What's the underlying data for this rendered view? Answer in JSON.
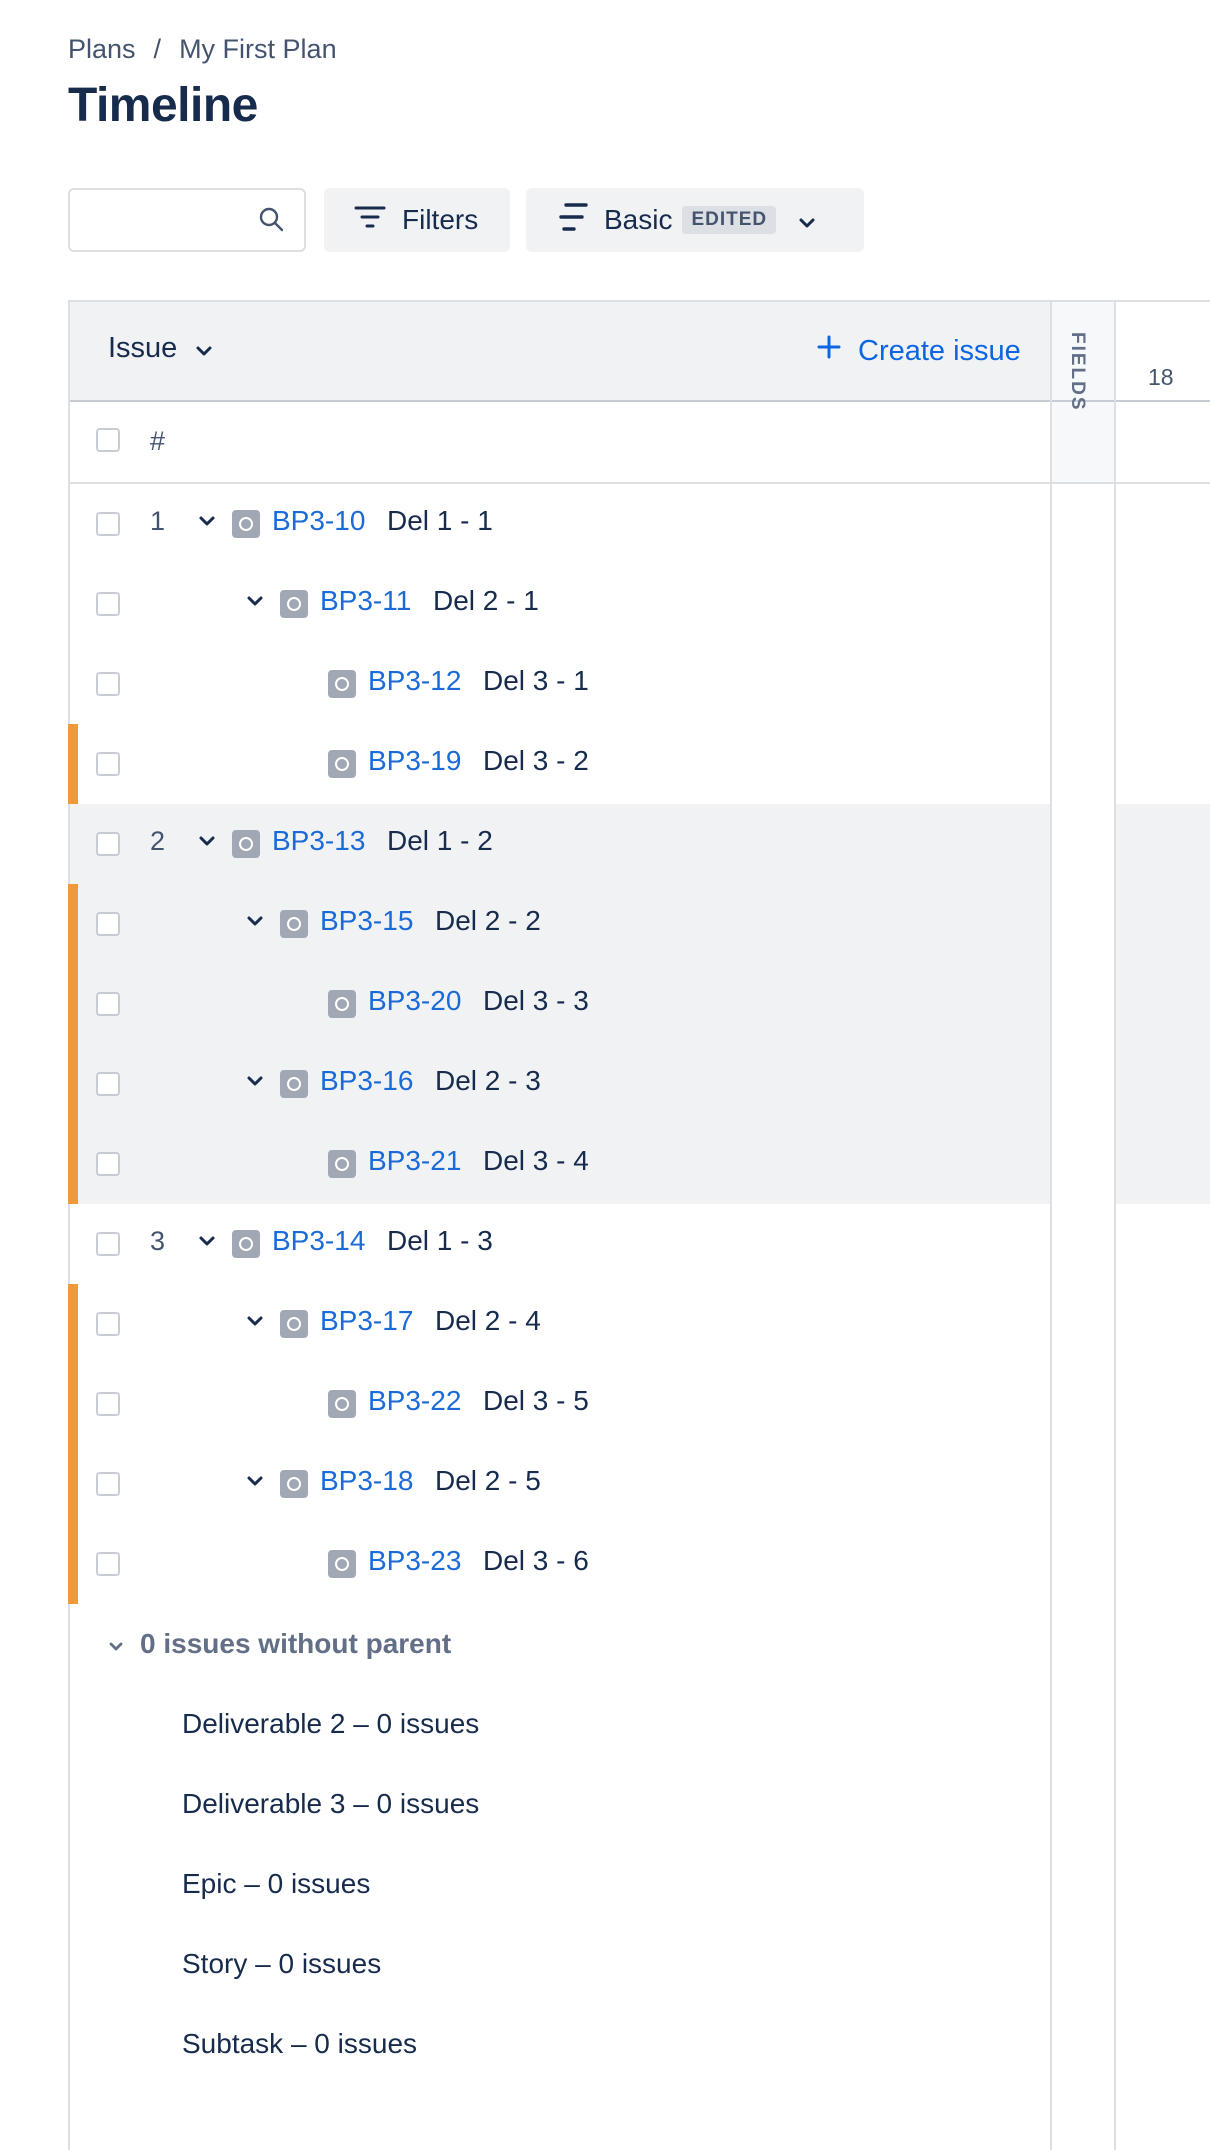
{
  "breadcrumb": {
    "parent": "Plans",
    "separator": "/",
    "current": "My First Plan"
  },
  "page_title": "Timeline",
  "toolbar": {
    "search_placeholder": "",
    "filters_label": "Filters",
    "view_label": "Basic",
    "view_badge": "EDITED"
  },
  "grid": {
    "issue_header": "Issue",
    "create_issue_label": "Create issue",
    "fields_label": "FIELDS",
    "timeline_date": "18",
    "rank_header": "#"
  },
  "rows": [
    {
      "num": "1",
      "key": "BP3-10",
      "summary": "Del 1 - 1",
      "level": 0,
      "expandable": true,
      "shaded": false,
      "flagged": false
    },
    {
      "num": "",
      "key": "BP3-11",
      "summary": "Del 2 - 1",
      "level": 1,
      "expandable": true,
      "shaded": false,
      "flagged": false
    },
    {
      "num": "",
      "key": "BP3-12",
      "summary": "Del 3 - 1",
      "level": 2,
      "expandable": false,
      "shaded": false,
      "flagged": false
    },
    {
      "num": "",
      "key": "BP3-19",
      "summary": "Del 3 - 2",
      "level": 2,
      "expandable": false,
      "shaded": false,
      "flagged": true
    },
    {
      "num": "2",
      "key": "BP3-13",
      "summary": "Del 1 - 2",
      "level": 0,
      "expandable": true,
      "shaded": true,
      "flagged": false
    },
    {
      "num": "",
      "key": "BP3-15",
      "summary": "Del 2 - 2",
      "level": 1,
      "expandable": true,
      "shaded": true,
      "flagged": true
    },
    {
      "num": "",
      "key": "BP3-20",
      "summary": "Del 3 - 3",
      "level": 2,
      "expandable": false,
      "shaded": true,
      "flagged": true
    },
    {
      "num": "",
      "key": "BP3-16",
      "summary": "Del 2 - 3",
      "level": 1,
      "expandable": true,
      "shaded": true,
      "flagged": true
    },
    {
      "num": "",
      "key": "BP3-21",
      "summary": "Del 3 - 4",
      "level": 2,
      "expandable": false,
      "shaded": true,
      "flagged": true
    },
    {
      "num": "3",
      "key": "BP3-14",
      "summary": "Del 1 - 3",
      "level": 0,
      "expandable": true,
      "shaded": false,
      "flagged": false
    },
    {
      "num": "",
      "key": "BP3-17",
      "summary": "Del 2 - 4",
      "level": 1,
      "expandable": true,
      "shaded": false,
      "flagged": true
    },
    {
      "num": "",
      "key": "BP3-22",
      "summary": "Del 3 - 5",
      "level": 2,
      "expandable": false,
      "shaded": false,
      "flagged": true
    },
    {
      "num": "",
      "key": "BP3-18",
      "summary": "Del 2 - 5",
      "level": 1,
      "expandable": true,
      "shaded": false,
      "flagged": true
    },
    {
      "num": "",
      "key": "BP3-23",
      "summary": "Del 3 - 6",
      "level": 2,
      "expandable": false,
      "shaded": false,
      "flagged": true
    }
  ],
  "no_parent": {
    "toggle_label": "0 issues without parent",
    "items": [
      "Deliverable 2 – 0 issues",
      "Deliverable 3 – 0 issues",
      "Epic – 0 issues",
      "Story – 0 issues",
      "Subtask – 0 issues"
    ]
  },
  "colors": {
    "link": "#1d6ad6",
    "accent_bar": "#f0993a",
    "shaded_row": "#f1f2f4",
    "text": "#172b4d"
  }
}
